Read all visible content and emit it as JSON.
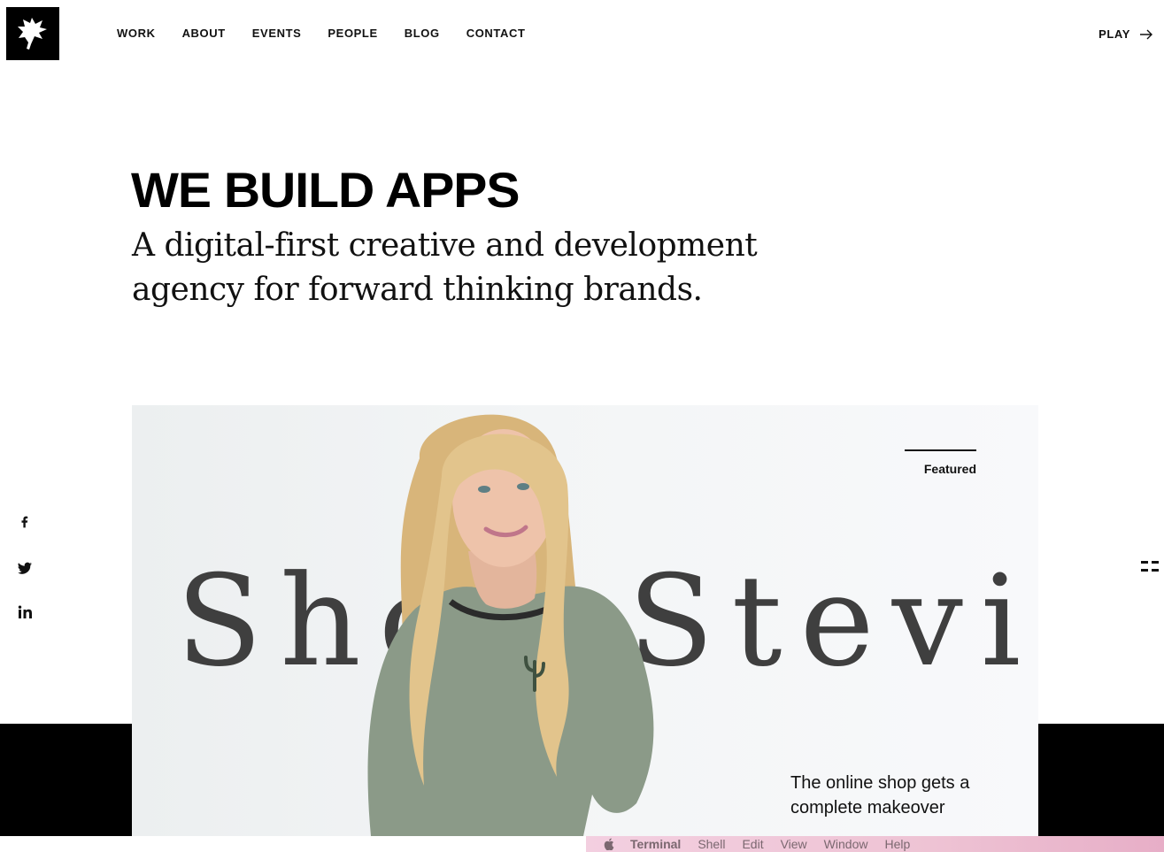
{
  "nav": {
    "items": [
      "WORK",
      "ABOUT",
      "EVENTS",
      "PEOPLE",
      "BLOG",
      "CONTACT"
    ],
    "play_label": "PLAY",
    "play_icon": "arrow-right-icon"
  },
  "hero": {
    "title": "WE BUILD APPS",
    "subtitle": "A digital-first creative and development agency for forward thinking brands."
  },
  "social": {
    "icons": [
      "facebook-icon",
      "twitter-icon",
      "linkedin-icon"
    ]
  },
  "feature": {
    "badge": "Featured",
    "big_word": "Shop Stevie",
    "caption": "The online shop gets a complete makeover"
  },
  "menubar": {
    "app_name": "Terminal",
    "items": [
      "Shell",
      "Edit",
      "View",
      "Window",
      "Help"
    ]
  },
  "colors": {
    "brand_black": "#000000",
    "menubar_pink": "#eec3d4"
  }
}
